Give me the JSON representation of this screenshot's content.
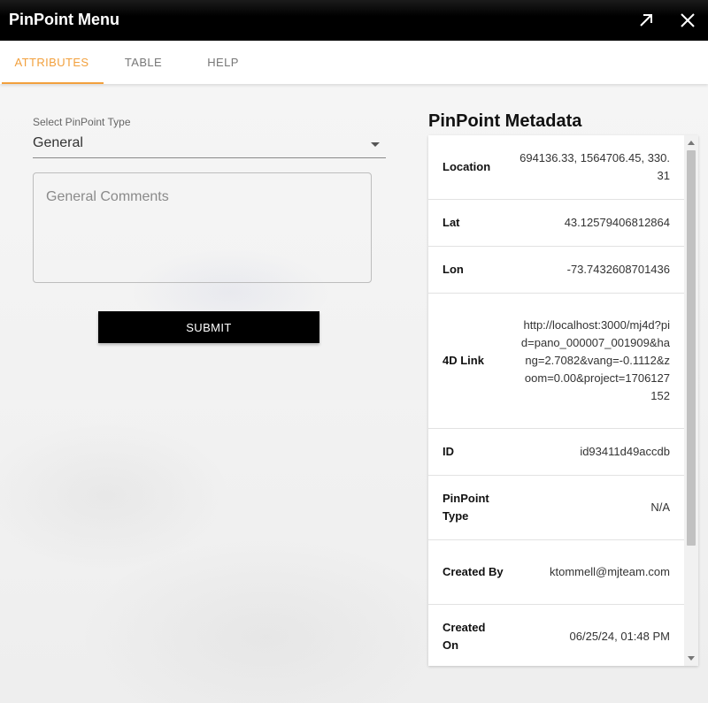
{
  "window": {
    "title": "PinPoint Menu",
    "expand_icon": "expand-arrow-icon",
    "close_icon": "close-icon"
  },
  "tabs": [
    {
      "label": "ATTRIBUTES",
      "active": true
    },
    {
      "label": "TABLE",
      "active": false
    },
    {
      "label": "HELP",
      "active": false
    }
  ],
  "form": {
    "select_label": "Select PinPoint Type",
    "select_value": "General",
    "comments_placeholder": "General Comments",
    "comments_value": "",
    "submit_label": "SUBMIT"
  },
  "metadata": {
    "heading": "PinPoint Metadata",
    "rows": [
      {
        "key": "Location",
        "value": "694136.33, 1564706.45, 330.31"
      },
      {
        "key": "Lat",
        "value": "43.12579406812864"
      },
      {
        "key": "Lon",
        "value": "-73.7432608701436"
      },
      {
        "key": "4D Link",
        "value": "http://localhost:3000/mj4d?pid=pano_000007_001909&hang=2.7082&vang=-0.1112&zoom=0.00&project=1706127152"
      },
      {
        "key": "ID",
        "value": "id93411d49accdb"
      },
      {
        "key": "PinPoint Type",
        "value": "N/A"
      },
      {
        "key": "Created By",
        "value": "ktommell@mjteam.com"
      },
      {
        "key": "Created On",
        "value": "06/25/24, 01:48 PM"
      }
    ]
  },
  "colors": {
    "accent": "#f2a03d",
    "titlebar": "#000000",
    "submit_bg": "#000000"
  }
}
